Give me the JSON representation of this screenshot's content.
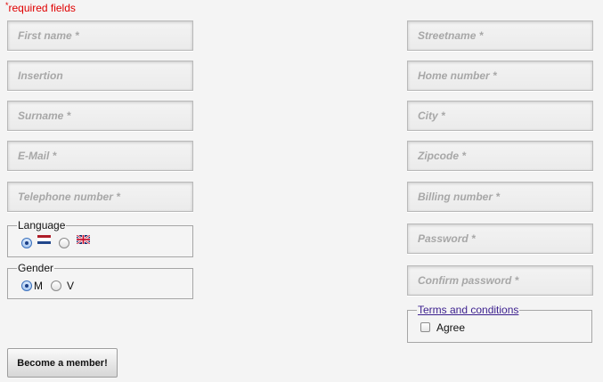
{
  "required_note": {
    "star": "*",
    "text": "required fields"
  },
  "left_fields": [
    {
      "placeholder": "First name *"
    },
    {
      "placeholder": "Insertion"
    },
    {
      "placeholder": "Surname *"
    },
    {
      "placeholder": "E-Mail *"
    },
    {
      "placeholder": "Telephone number *"
    }
  ],
  "right_fields": [
    {
      "placeholder": "Streetname *"
    },
    {
      "placeholder": "Home number *"
    },
    {
      "placeholder": "City *"
    },
    {
      "placeholder": "Zipcode *"
    },
    {
      "placeholder": "Billing number *"
    },
    {
      "placeholder": "Password *"
    },
    {
      "placeholder": "Confirm password *"
    }
  ],
  "language": {
    "legend": "Language",
    "options": [
      {
        "icon": "flag-netherlands-icon",
        "selected": true
      },
      {
        "icon": "flag-united-kingdom-icon",
        "selected": false
      }
    ]
  },
  "gender": {
    "legend": "Gender",
    "options": [
      {
        "label": "M",
        "selected": true
      },
      {
        "label": "V",
        "selected": false
      }
    ]
  },
  "terms": {
    "link_label": "Terms and conditions",
    "agree_label": "Agree",
    "agree_checked": false
  },
  "submit_label": "Become a member!",
  "colors": {
    "required": "#e00000",
    "link": "#3b1f8e",
    "radio_selected": "#1b3f86"
  }
}
